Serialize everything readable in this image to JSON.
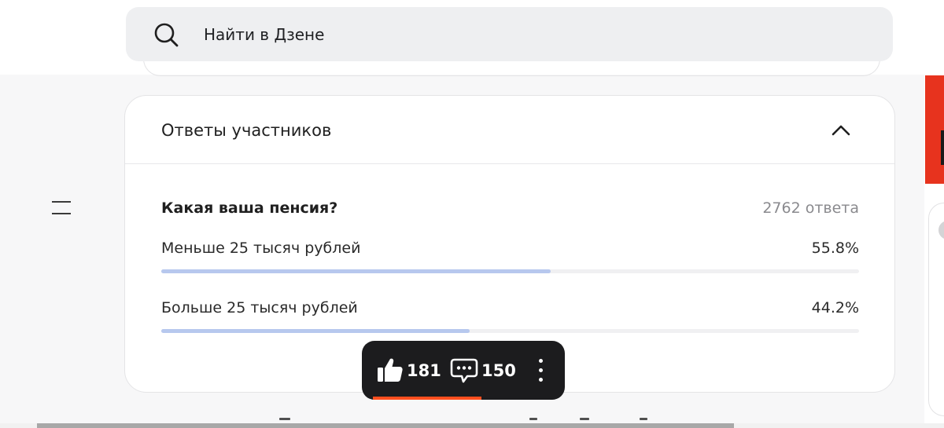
{
  "search": {
    "placeholder": "Найти в Дзене",
    "icon": "search-icon"
  },
  "poll": {
    "title": "Ответы участников",
    "collapse_icon": "chevron-up-icon",
    "question": "Какая ваша пенсия?",
    "answers_count": "2762 ответа",
    "options": [
      {
        "label": "Меньше 25 тысяч рублей",
        "percent_text": "55.8%",
        "fraction": 0.558
      },
      {
        "label": "Больше 25 тысяч рублей",
        "percent_text": "44.2%",
        "fraction": 0.442
      }
    ]
  },
  "actions": {
    "likes": "181",
    "comments": "150",
    "like_icon": "thumbs-up-icon",
    "comment_icon": "comment-icon",
    "more_icon": "more-vertical-icon"
  },
  "colors": {
    "bar_fill": "#b7c8ee",
    "bar_track": "#f0f0f2",
    "action_bar_bg": "#1c1c1e",
    "accent": "#ff4f1f",
    "side_banner": "#e7331e"
  }
}
